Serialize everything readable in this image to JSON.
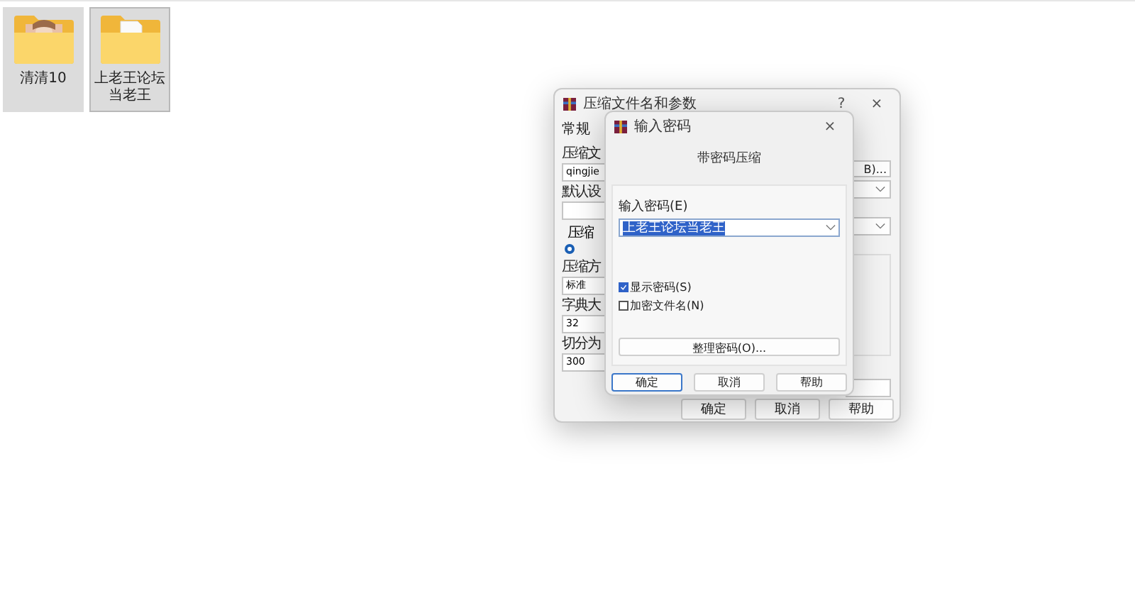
{
  "desktop": {
    "icons": [
      {
        "label": "清清10",
        "selected": true
      },
      {
        "label": "上老王论坛当老王",
        "selected": true,
        "kind": "document"
      }
    ]
  },
  "archive_dialog": {
    "title": "压缩文件名和参数",
    "help": "?",
    "close": "×",
    "tab": "常规",
    "left_items": [
      {
        "kind": "label",
        "text": "压缩文"
      },
      {
        "kind": "field",
        "text": "qingjie"
      },
      {
        "kind": "label",
        "text": "默认设"
      },
      {
        "kind": "field"
      },
      {
        "kind": "group",
        "text": "压缩"
      },
      {
        "kind": "radio",
        "checked": true
      },
      {
        "kind": "label",
        "text": "压缩方"
      },
      {
        "kind": "field",
        "text": "标准"
      },
      {
        "kind": "label",
        "text": "字典大"
      },
      {
        "kind": "field",
        "text": "32"
      },
      {
        "kind": "label",
        "text": "切分为"
      },
      {
        "kind": "field",
        "text": "300"
      }
    ],
    "browse_button": "B)...",
    "buttons": [
      "确定",
      "取消",
      "帮助"
    ]
  },
  "password_dialog": {
    "title": "输入密码",
    "close": "×",
    "heading": "带密码压缩",
    "password": {
      "label": "输入密码(E)",
      "value": "上老王论坛当老王",
      "selected": true
    },
    "options": [
      {
        "label": "显示密码(S)",
        "checked": true
      },
      {
        "label": "加密文件名(N)",
        "checked": false
      }
    ],
    "organize_button": "整理密码(O)...",
    "buttons": [
      {
        "label": "确定",
        "focused": true
      },
      {
        "label": "取消",
        "focused": false
      },
      {
        "label": "帮助",
        "focused": false
      }
    ]
  }
}
